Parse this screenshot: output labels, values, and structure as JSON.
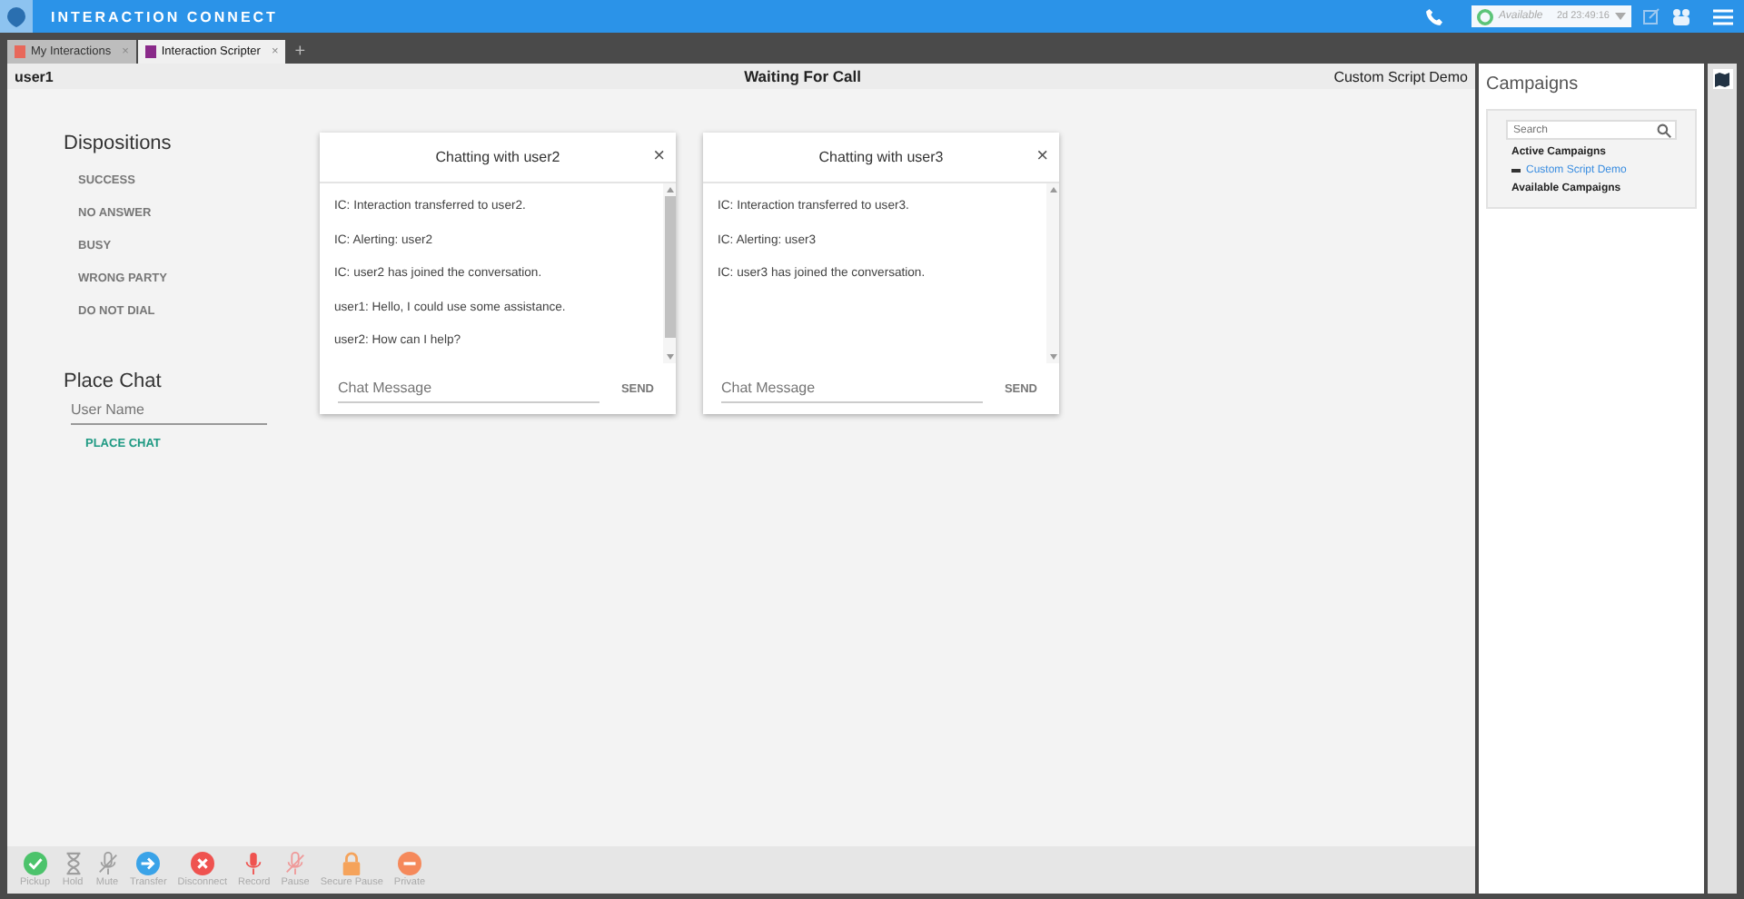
{
  "app": {
    "title": "INTERACTION CONNECT",
    "status": "Available",
    "status_time": "2d 23:49:16"
  },
  "tabs": [
    {
      "label": "My Interactions",
      "selected": false,
      "close": "×"
    },
    {
      "label": "Interaction Scripter",
      "selected": true,
      "close": "×"
    }
  ],
  "add_tab": "+",
  "header": {
    "user": "user1",
    "status": "Waiting For Call",
    "script": "Custom Script Demo"
  },
  "dispositions": {
    "title": "Dispositions",
    "items": [
      "SUCCESS",
      "NO ANSWER",
      "BUSY",
      "WRONG PARTY",
      "DO NOT DIAL"
    ]
  },
  "place_chat": {
    "title": "Place Chat",
    "placeholder": "User Name",
    "button": "PLACE CHAT"
  },
  "chats": [
    {
      "title": "Chatting with user2",
      "close": "×",
      "messages": [
        "IC: Interaction transferred to user2.",
        "IC: Alerting: user2",
        "IC: user2 has joined the conversation.",
        "user1: Hello, I could use some assistance.",
        "user2: How can I help?"
      ],
      "scroll_thumb": true,
      "placeholder": "Chat Message",
      "send": "SEND"
    },
    {
      "title": "Chatting with user3",
      "close": "×",
      "messages": [
        "IC: Interaction transferred to user3.",
        "IC: Alerting: user3",
        "IC: user3 has joined the conversation."
      ],
      "scroll_thumb": false,
      "placeholder": "Chat Message",
      "send": "SEND"
    }
  ],
  "campaigns": {
    "title": "Campaigns",
    "search_placeholder": "Search",
    "active_heading": "Active Campaigns",
    "active": [
      "Custom Script Demo"
    ],
    "available_heading": "Available Campaigns"
  },
  "toolbar": [
    {
      "label": "Pickup",
      "kind": "check",
      "color": "#4cc36b"
    },
    {
      "label": "Hold",
      "kind": "hourglass",
      "color": "#9e9e9e"
    },
    {
      "label": "Mute",
      "kind": "mic-off",
      "color": "#9e9e9e"
    },
    {
      "label": "Transfer",
      "kind": "arrow",
      "color": "#3aa3e8"
    },
    {
      "label": "Disconnect",
      "kind": "x",
      "color": "#ef5350"
    },
    {
      "label": "Record",
      "kind": "mic",
      "color": "#ef5350"
    },
    {
      "label": "Pause",
      "kind": "mic-off",
      "color": "#ef9a9a"
    },
    {
      "label": "Secure Pause",
      "kind": "lock",
      "color": "#f5a35b"
    },
    {
      "label": "Private",
      "kind": "minus",
      "color": "#f5895b"
    }
  ]
}
